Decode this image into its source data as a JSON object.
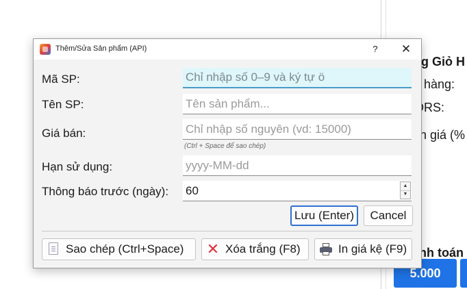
{
  "background": {
    "texts": [
      "g Giỏ H",
      "hàng:",
      "DRS:",
      "n giá (%",
      "nh toán"
    ],
    "amount": "5.000",
    "accent": "#1f73e6"
  },
  "dialog": {
    "title": "Thêm/Sửa Sản phẩm (API)",
    "help_label": "?",
    "close_label": "✕",
    "fields": {
      "ma_sp": {
        "label": "Mã SP:",
        "placeholder": "Chỉ nhập số 0–9 và ký tự ö",
        "value": ""
      },
      "ten_sp": {
        "label": "Tên SP:",
        "placeholder": "Tên sản phẩm...",
        "value": ""
      },
      "gia_ban": {
        "label": "Giá bán:",
        "placeholder": "Chỉ nhập số nguyên (vd: 15000)",
        "value": "",
        "hint": "(Ctrl + Space để sao chép)"
      },
      "han_su_dung": {
        "label": "Hạn sử dụng:",
        "placeholder": "yyyy-MM-dd",
        "value": ""
      },
      "thong_bao": {
        "label": "Thông báo trước (ngày):",
        "value": "60"
      }
    },
    "buttons": {
      "save": "Lưu (Enter)",
      "cancel": "Cancel",
      "copy": "Sao chép (Ctrl+Space)",
      "clear": "Xóa trắng (F8)",
      "print": "In giá kệ (F9)"
    },
    "icons": {
      "copy": "copy-document-icon",
      "clear": "red-x-icon",
      "print": "printer-icon",
      "app": "app-icon"
    }
  }
}
